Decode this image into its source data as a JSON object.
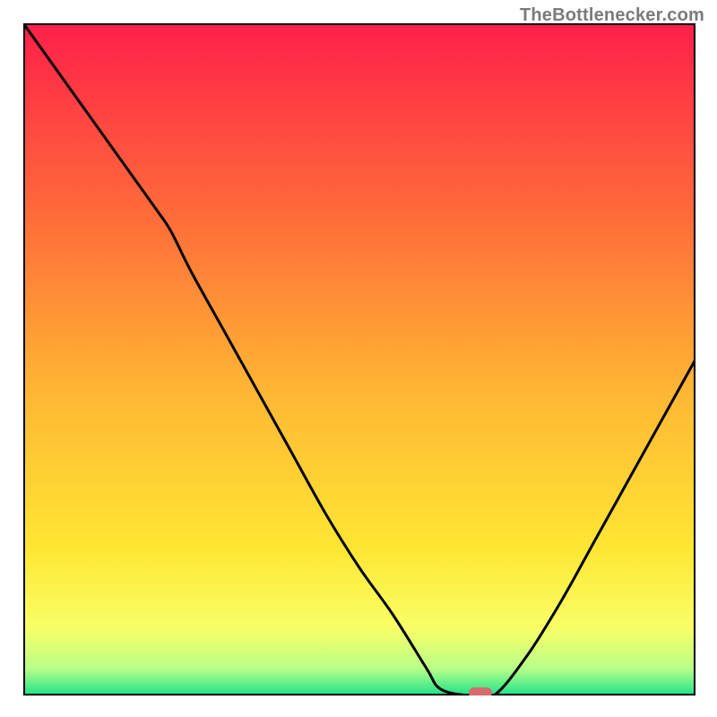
{
  "attribution": "TheBottlenecker.com",
  "chart_data": {
    "type": "line",
    "title": "",
    "xlabel": "",
    "ylabel": "",
    "xlim": [
      0,
      100
    ],
    "ylim": [
      0,
      100
    ],
    "x": [
      0,
      5,
      10,
      15,
      20,
      22,
      25,
      30,
      35,
      40,
      45,
      50,
      55,
      60,
      62,
      66,
      70,
      75,
      80,
      85,
      90,
      95,
      100
    ],
    "y": [
      100,
      93,
      86,
      79,
      72,
      69,
      63,
      54,
      45,
      36,
      27,
      19,
      12,
      4,
      1,
      0,
      0,
      6,
      14,
      23,
      32,
      41,
      50
    ],
    "background_gradient": {
      "stops": [
        {
          "offset": 0.0,
          "color": "#ff1f4a"
        },
        {
          "offset": 0.28,
          "color": "#ff6a3a"
        },
        {
          "offset": 0.55,
          "color": "#ffb733"
        },
        {
          "offset": 0.78,
          "color": "#ffe633"
        },
        {
          "offset": 0.9,
          "color": "#f8ff66"
        },
        {
          "offset": 0.96,
          "color": "#b8ff88"
        },
        {
          "offset": 1.0,
          "color": "#1de28a"
        }
      ]
    },
    "marker": {
      "x": 68,
      "y": 0,
      "color": "#d66b6b"
    },
    "axes_color": "#000000",
    "curve_color": "#000000"
  }
}
